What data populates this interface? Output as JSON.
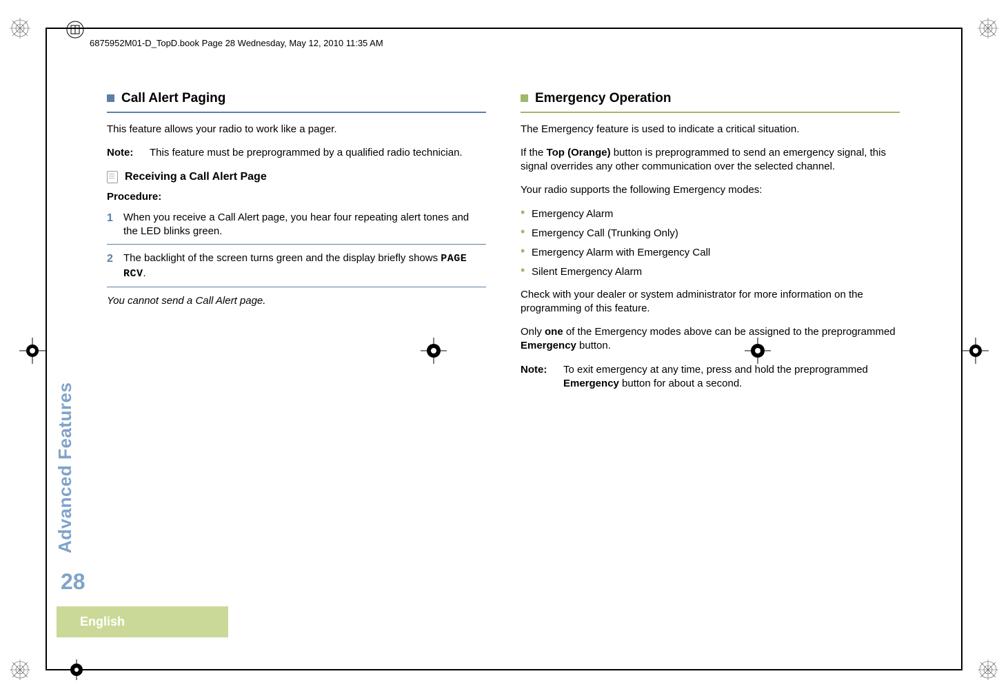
{
  "header": {
    "running_head": "6875952M01-D_TopD.book  Page 28  Wednesday, May 12, 2010  11:35 AM"
  },
  "sidebar": {
    "tab_label": "Advanced Features",
    "page_number": "28",
    "language": "English"
  },
  "left": {
    "title": "Call Alert Paging",
    "intro": "This feature allows your radio to work like a pager.",
    "note_label": "Note:",
    "note_text": "This feature must be preprogrammed by a qualified radio technician.",
    "subhead": "Receiving a Call Alert Page",
    "procedure_label": "Procedure:",
    "steps": [
      {
        "num": "1",
        "text": "When you receive a Call Alert page, you hear four repeating alert tones and the LED blinks green."
      },
      {
        "num": "2",
        "text_pre": "The backlight of the screen turns green and the display briefly shows ",
        "code": "PAGE RCV",
        "text_post": "."
      }
    ],
    "footer_italic": "You cannot send a Call Alert page."
  },
  "right": {
    "title": "Emergency Operation",
    "p1": "The Emergency feature is used to indicate a critical situation.",
    "p2_pre": "If the ",
    "p2_bold": "Top (Orange)",
    "p2_post": " button is preprogrammed to send an emergency signal, this signal overrides any other communication over the selected channel.",
    "p3": "Your radio supports the following Emergency modes:",
    "bullets": [
      "Emergency Alarm",
      "Emergency Call (Trunking Only)",
      "Emergency Alarm with Emergency Call",
      "Silent Emergency Alarm"
    ],
    "p4": "Check with your dealer or system administrator for more information on the programming of this feature.",
    "p5_pre": "Only ",
    "p5_bold1": "one",
    "p5_mid": " of the Emergency modes above can be assigned to the preprogrammed ",
    "p5_bold2": "Emergency",
    "p5_post": " button.",
    "note_label": "Note:",
    "note_pre": "To exit emergency at any time, press and hold the preprogrammed ",
    "note_bold": "Emergency",
    "note_post": " button for about a second."
  }
}
